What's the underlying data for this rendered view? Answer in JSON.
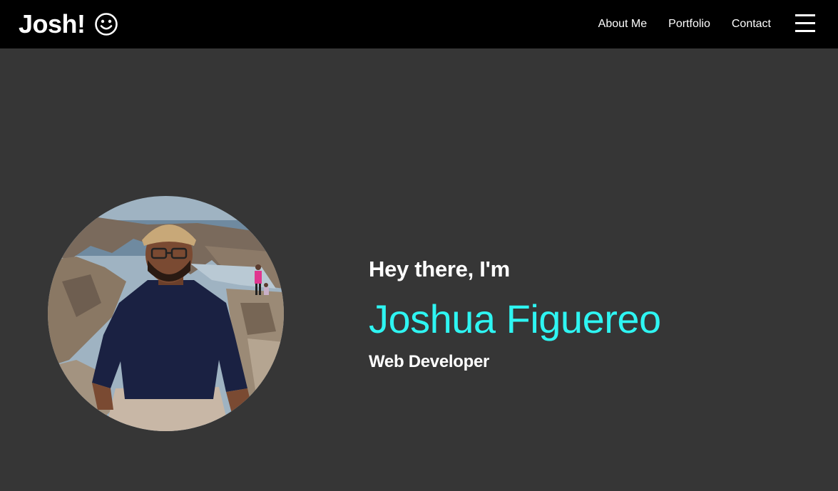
{
  "colors": {
    "navbar_background": "#000000",
    "page_background": "#363636",
    "text": "#ffffff",
    "accent": "#2ef5f2"
  },
  "navbar": {
    "brand": "Josh!",
    "brand_icon": "smiley-face-icon",
    "links": [
      {
        "label": "About Me"
      },
      {
        "label": "Portfolio"
      },
      {
        "label": "Contact"
      }
    ],
    "menu_icon": "hamburger-menu-icon"
  },
  "hero": {
    "greeting": "Hey there, I'm",
    "name": "Joshua Figuereo",
    "role": "Web Developer",
    "photo": "profile-photo"
  }
}
